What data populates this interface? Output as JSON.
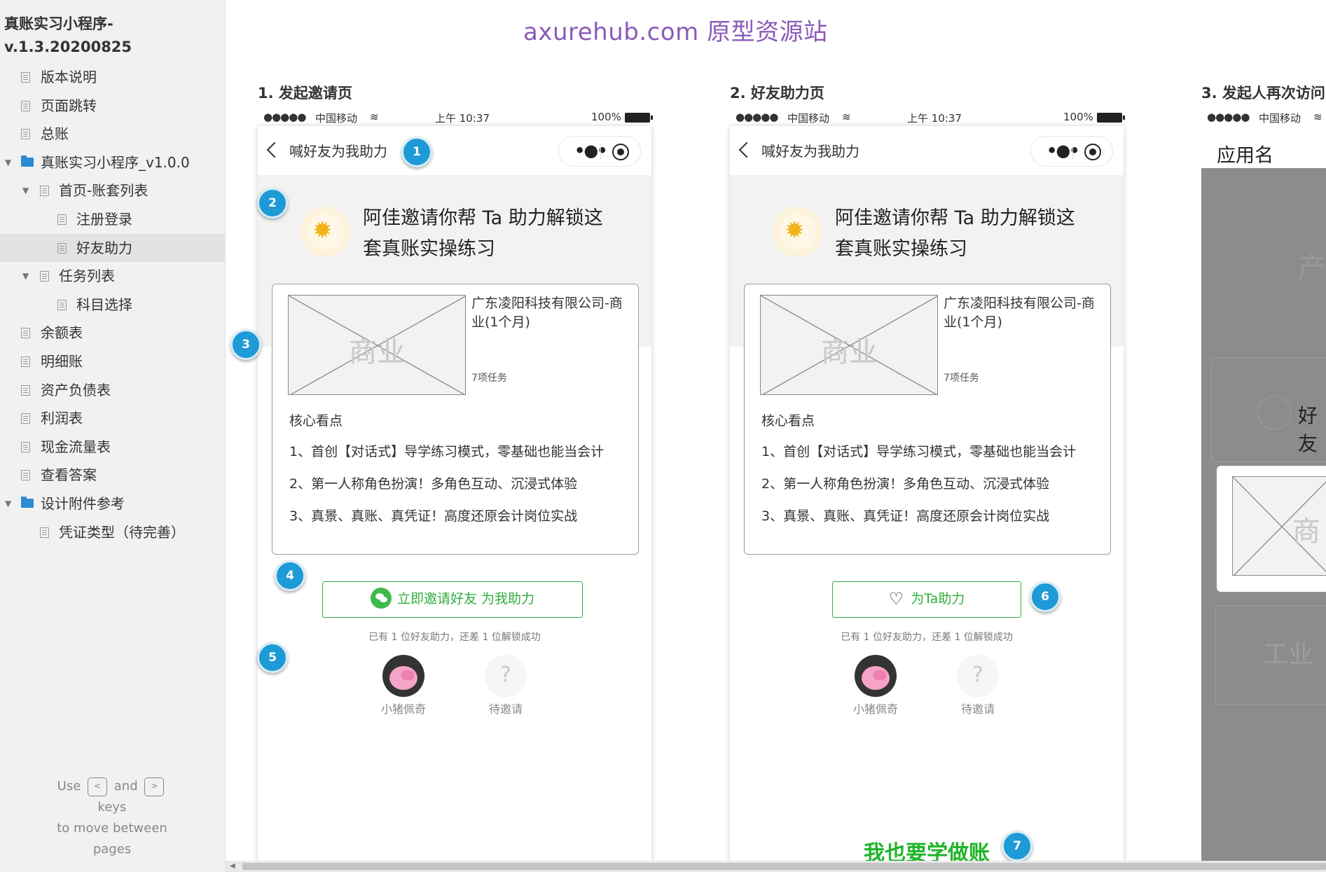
{
  "sidebar": {
    "title_line1": "真账实习小程序-",
    "title_line2": "v.1.3.20200825",
    "items": [
      {
        "label": "版本说明",
        "level": 1,
        "type": "page"
      },
      {
        "label": "页面跳转",
        "level": 1,
        "type": "page"
      },
      {
        "label": "总账",
        "level": 1,
        "type": "page"
      },
      {
        "label": "真账实习小程序_v1.0.0",
        "level": 0,
        "type": "folder",
        "expanded": true
      },
      {
        "label": "首页-账套列表",
        "level": 1,
        "type": "page",
        "expanded": true
      },
      {
        "label": "注册登录",
        "level": 2,
        "type": "page"
      },
      {
        "label": "好友助力",
        "level": 2,
        "type": "page",
        "selected": true
      },
      {
        "label": "任务列表",
        "level": 1,
        "type": "page",
        "expanded": true
      },
      {
        "label": "科目选择",
        "level": 2,
        "type": "page"
      },
      {
        "label": "余额表",
        "level": 1,
        "type": "page"
      },
      {
        "label": "明细账",
        "level": 1,
        "type": "page"
      },
      {
        "label": "资产负债表",
        "level": 1,
        "type": "page"
      },
      {
        "label": "利润表",
        "level": 1,
        "type": "page"
      },
      {
        "label": "现金流量表",
        "level": 1,
        "type": "page"
      },
      {
        "label": "查看答案",
        "level": 1,
        "type": "page"
      },
      {
        "label": "设计附件参考",
        "level": 0,
        "type": "folder",
        "expanded": true
      },
      {
        "label": "凭证类型（待完善）",
        "level": 1,
        "type": "page"
      }
    ],
    "hint": {
      "use": "Use",
      "key_prev": "<",
      "and": "and",
      "key_next": ">",
      "keys": "keys",
      "to_move": "to move between",
      "pages": "pages"
    }
  },
  "watermark": "axurehub.com 原型资源站",
  "statusbar": {
    "signal": "●●●●●",
    "carrier": "中国移动",
    "wifi": "≋",
    "time": "上午 10:37",
    "battery_pct": "100%"
  },
  "screens": [
    {
      "title": "1. 发起邀请页",
      "nav_title": "喊好友为我助力",
      "invite_line1": "阿佳邀请你帮 Ta 助力解锁这",
      "invite_line2": "套真账实操练习",
      "placeholder_label": "商业",
      "company_name": "广东凌阳科技有限公司-商业(1个月)",
      "tasks": "7项任务",
      "core_title": "核心看点",
      "core_points": [
        "1、首创【对话式】导学练习模式，零基础也能当会计",
        "2、第一人称角色扮演！多角色互动、沉浸式体验",
        "3、真景、真账、真凭证！高度还原会计岗位实战"
      ],
      "button_label": "立即邀请好友 为我助力",
      "progress_text": "已有 1 位好友助力，还差 1 位解锁成功",
      "friend_name": "小猪佩奇",
      "pending_label": "待邀请",
      "pending_glyph": "?",
      "markers": [
        "1",
        "2",
        "3",
        "4",
        "5"
      ]
    },
    {
      "title": "2. 好友助力页",
      "nav_title": "喊好友为我助力",
      "invite_line1": "阿佳邀请你帮 Ta 助力解锁这",
      "invite_line2": "套真账实操练习",
      "placeholder_label": "商业",
      "company_name": "广东凌阳科技有限公司-商业(1个月)",
      "tasks": "7项任务",
      "core_title": "核心看点",
      "core_points": [
        "1、首创【对话式】导学练习模式，零基础也能当会计",
        "2、第一人称角色扮演！多角色互动、沉浸式体验",
        "3、真景、真账、真凭证！高度还原会计岗位实战"
      ],
      "button_label": "为Ta助力",
      "progress_text": "已有 1 位好友助力，还差 1 位解锁成功",
      "friend_name": "小猪佩奇",
      "pending_label": "待邀请",
      "pending_glyph": "?",
      "learn_label": "我也要学做账",
      "markers": [
        "6",
        "7"
      ]
    },
    {
      "title": "3. 发起人再次访问",
      "app_name": "应用名",
      "ghost_text": "产",
      "friend_partial": "好友",
      "placeholder_label": "商",
      "ghost_text2": "工业"
    }
  ],
  "colors": {
    "accent_blue": "#1e9ad6",
    "wechat_green": "#2fae3b",
    "watermark_purple": "#8a5bb8",
    "folder_blue": "#2b8bd3"
  }
}
